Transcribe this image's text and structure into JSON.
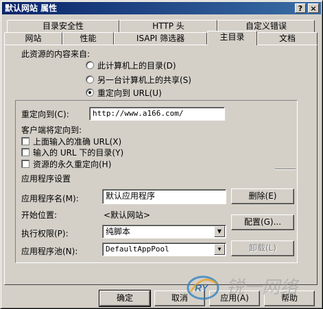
{
  "window": {
    "title": "默认网站 属性",
    "help_btn": "?",
    "close_btn": "×"
  },
  "tabs_row1": [
    {
      "label": "目录安全性"
    },
    {
      "label": "HTTP 头"
    },
    {
      "label": "自定义错误"
    }
  ],
  "tabs_row2": [
    {
      "label": "网站"
    },
    {
      "label": "性能"
    },
    {
      "label": "ISAPI 筛选器"
    },
    {
      "label": "主目录",
      "active": true
    },
    {
      "label": "文档"
    }
  ],
  "content_source": {
    "heading": "此资源的内容来自:",
    "options": [
      {
        "label": "此计算机上的目录(D)",
        "selected": false
      },
      {
        "label": "另一台计算机上的共享(S)",
        "selected": false
      },
      {
        "label": "重定向到 URL(U)",
        "selected": true
      }
    ]
  },
  "redirect": {
    "label": "重定向到(C):",
    "value": "http://www.a166.com/",
    "client_label": "客户端将定向到:",
    "checkboxes": [
      {
        "label": "上面输入的准确 URL(X)",
        "checked": false
      },
      {
        "label": "输入的 URL 下的目录(Y)",
        "checked": false
      },
      {
        "label": "资源的永久重定向(H)",
        "checked": false
      }
    ]
  },
  "app_settings": {
    "heading": "应用程序设置",
    "app_name_label": "应用程序名(M):",
    "app_name_value": "默认应用程序",
    "start_label": "开始位置:",
    "start_value": "<默认网站>",
    "exec_label": "执行权限(P):",
    "exec_value": "纯脚本",
    "pool_label": "应用程序池(N):",
    "pool_value": "DefaultAppPool",
    "remove_btn": "删除(E)",
    "config_btn": "配置(G)...",
    "unload_btn": "卸载(L)"
  },
  "footer": {
    "ok": "确定",
    "cancel": "取消",
    "apply": "应用(A)",
    "help": "帮助"
  },
  "watermark": {
    "logo": "RY",
    "text": "锐一网络"
  }
}
